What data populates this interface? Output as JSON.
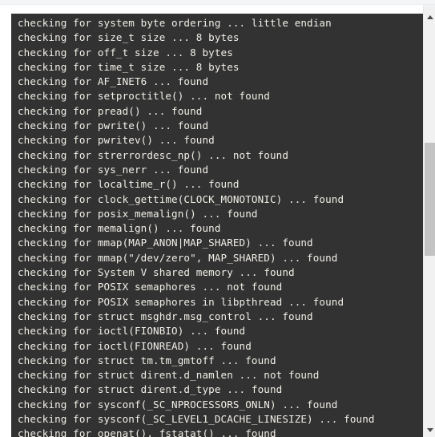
{
  "window": {
    "background_color": "#ffffff",
    "top_strip_color": "#f4f5f6"
  },
  "console": {
    "background_color": "#323232",
    "text_color": "#f2efe8",
    "lines": [
      "checking for system byte ordering ... little endian",
      "checking for size_t size ... 8 bytes",
      "checking for off_t size ... 8 bytes",
      "checking for time_t size ... 8 bytes",
      "checking for AF_INET6 ... found",
      "checking for setproctitle() ... not found",
      "checking for pread() ... found",
      "checking for pwrite() ... found",
      "checking for pwritev() ... found",
      "checking for strerrordesc_np() ... not found",
      "checking for sys_nerr ... found",
      "checking for localtime_r() ... found",
      "checking for clock_gettime(CLOCK_MONOTONIC) ... found",
      "checking for posix_memalign() ... found",
      "checking for memalign() ... found",
      "checking for mmap(MAP_ANON|MAP_SHARED) ... found",
      "checking for mmap(\"/dev/zero\", MAP_SHARED) ... found",
      "checking for System V shared memory ... found",
      "checking for POSIX semaphores ... not found",
      "checking for POSIX semaphores in libpthread ... found",
      "checking for struct msghdr.msg_control ... found",
      "checking for ioctl(FIONBIO) ... found",
      "checking for ioctl(FIONREAD) ... found",
      "checking for struct tm.tm_gmtoff ... found",
      "checking for struct dirent.d_namlen ... not found",
      "checking for struct dirent.d_type ... found",
      "checking for sysconf(_SC_NPROCESSORS_ONLN) ... found",
      "checking for sysconf(_SC_LEVEL1_DCACHE_LINESIZE) ... found",
      "checking for openat(), fstatat() ... found"
    ]
  },
  "scrollbar": {
    "track_color": "#f1f1f1",
    "thumb_color": "#c3c3c3",
    "up_arrow_icon": "scroll-up-arrow-icon",
    "down_arrow_icon": "scroll-down-arrow-icon"
  }
}
